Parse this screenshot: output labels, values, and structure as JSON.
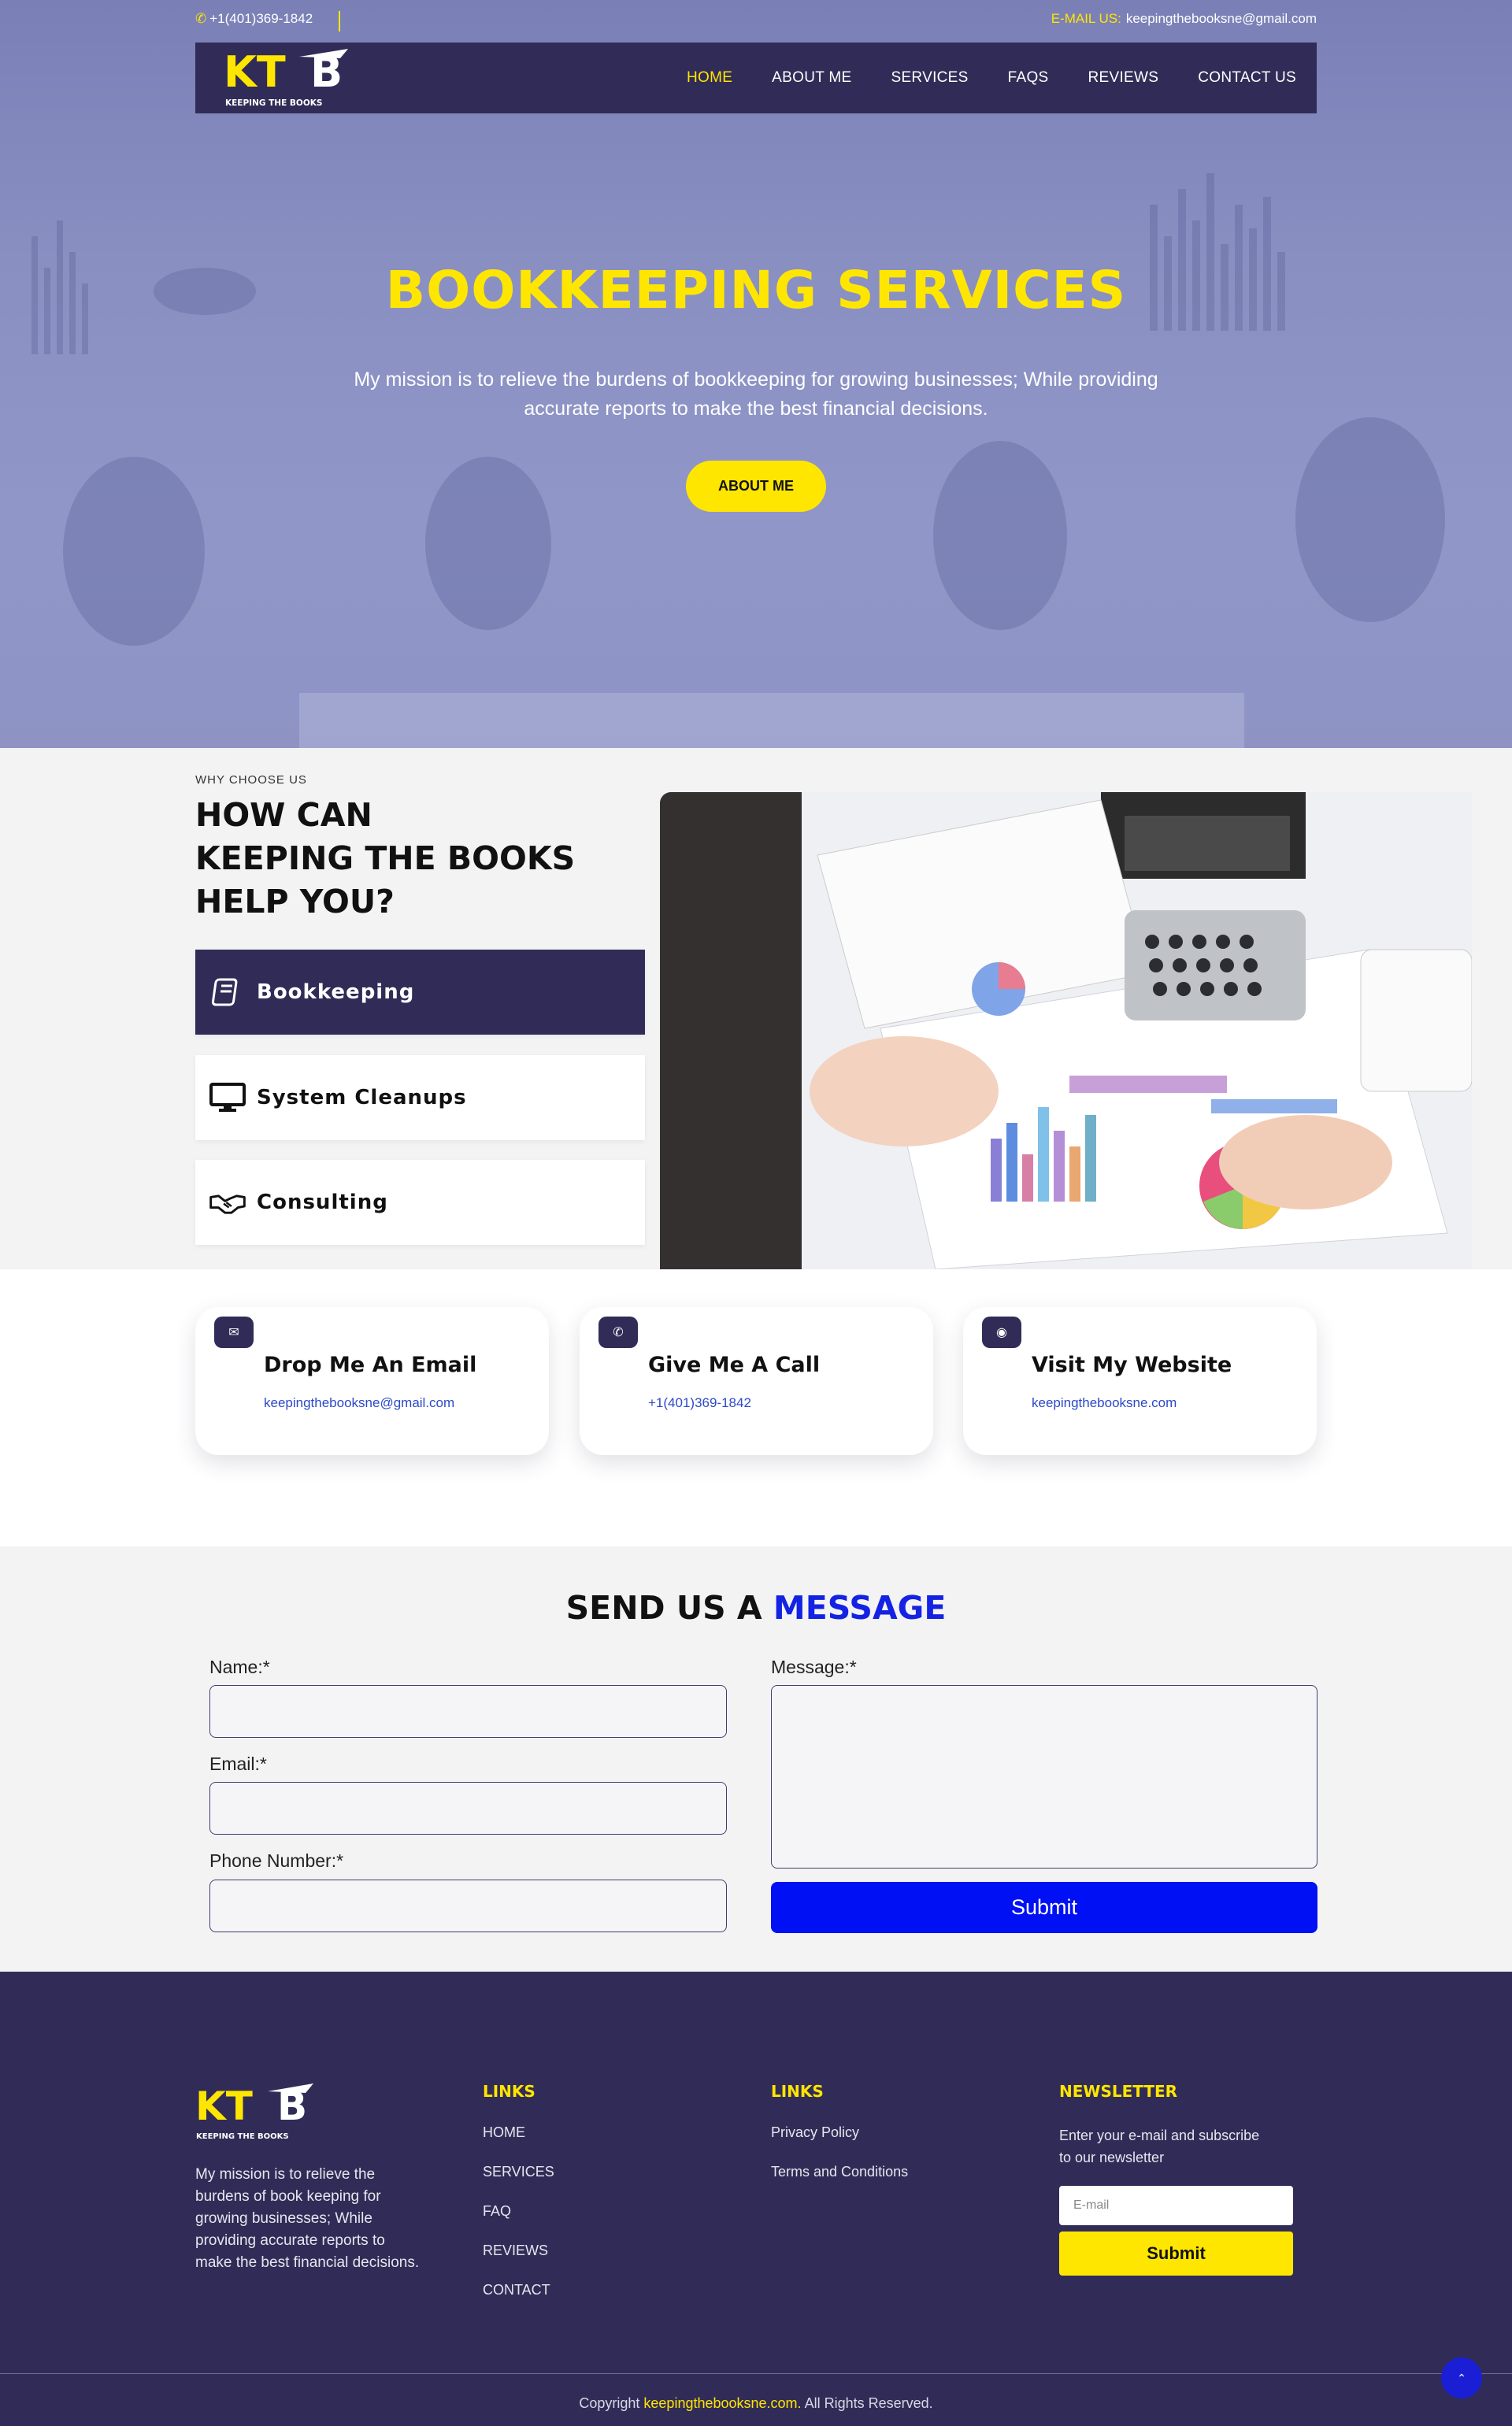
{
  "topbar": {
    "phone": "+1(401)369-1842",
    "email_label": "E-MAIL US:",
    "email": "keepingthebooksne@gmail.com"
  },
  "brand": {
    "logo_text": "KTB",
    "logo_tagline": "KEEPING THE BOOKS"
  },
  "nav": {
    "items": [
      "HOME",
      "ABOUT ME",
      "SERVICES",
      "FAQS",
      "REVIEWS",
      "CONTACT US"
    ],
    "active": "HOME"
  },
  "hero": {
    "title": "BOOKKEEPING SERVICES",
    "subtitle": "My mission is to relieve the burdens of bookkeeping for growing businesses; While providing accurate reports to make the best financial decisions.",
    "button": "ABOUT ME"
  },
  "why": {
    "eyebrow": "WHY CHOOSE US",
    "title_line1": "HOW CAN",
    "title_line2": "KEEPING THE BOOKS",
    "title_line3": "HELP YOU?",
    "services": [
      {
        "label": "Bookkeeping",
        "icon": "book-icon"
      },
      {
        "label": "System Cleanups",
        "icon": "monitor-icon"
      },
      {
        "label": "Consulting",
        "icon": "handshake-icon"
      }
    ]
  },
  "contact_cards": [
    {
      "title": "Drop Me An Email",
      "value": "keepingthebooksne@gmail.com",
      "icon": "envelope-icon"
    },
    {
      "title": "Give Me A Call",
      "value": "+1(401)369-1842",
      "icon": "phone-icon"
    },
    {
      "title": "Visit My Website",
      "value": "keepingthebooksne.com",
      "icon": "globe-icon"
    }
  ],
  "form": {
    "title_prefix": "SEND US A",
    "title_highlight": "MESSAGE",
    "name_label": "Name:*",
    "email_label": "Email:*",
    "phone_label": "Phone Number:*",
    "message_label": "Message:*",
    "submit": "Submit"
  },
  "footer": {
    "about": "My mission is to relieve the burdens of book keeping for growing businesses; While providing accurate reports to make the best financial decisions.",
    "links1_title": "LINKS",
    "links1": [
      "HOME",
      "SERVICES",
      "FAQ",
      "REVIEWS",
      "CONTACT"
    ],
    "links2_title": "LINKS",
    "links2": [
      "Privacy Policy",
      "Terms and Conditions"
    ],
    "newsletter_title": "NEWSLETTER",
    "newsletter_text": "Enter your e-mail and subscribe to our newsletter",
    "newsletter_placeholder": "E-mail",
    "newsletter_button": "Submit",
    "copyright_prefix": "Copyright",
    "copyright_site": "keepingthebooksne.com.",
    "copyright_suffix": "All Rights Reserved."
  },
  "colors": {
    "navy": "#312c57",
    "yellow": "#ffe600",
    "blue": "#0010f5"
  }
}
